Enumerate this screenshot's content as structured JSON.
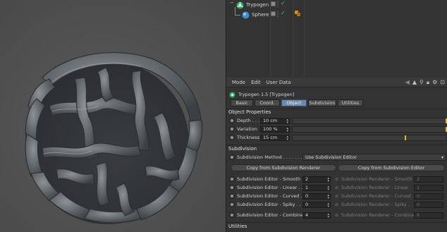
{
  "object_manager": {
    "objects": [
      {
        "name": "Trypogen",
        "icon": "trypogen-icon",
        "icon_color": "#2fae61"
      },
      {
        "name": "Sphere",
        "icon": "sphere-icon",
        "icon_color": "#4aa3df"
      }
    ]
  },
  "attribute_manager": {
    "menu": [
      "Mode",
      "Edit",
      "User Data"
    ],
    "object_title": "Trypogen 1.5 [Trypogen]",
    "tabs": [
      "Basic",
      "Coord.",
      "Object",
      "Subdivision",
      "Utilities"
    ],
    "active_tab": "Object",
    "object_properties": {
      "header": "Object Properties",
      "depth": {
        "label": "Depth . . . .",
        "value": "10 cm",
        "fraction": 1.0
      },
      "variation": {
        "label": "Variation",
        "value": "100 %",
        "fraction": 1.0
      },
      "thickness": {
        "label": "Thickness",
        "value": "15 cm",
        "fraction": 0.73
      }
    },
    "subdivision": {
      "header": "Subdivision",
      "method_label": "Subdivision Method . . . . . . . . .",
      "method_value": "Use Subdivision Editor",
      "copy_renderer_button": "Copy from Subdivision Renderer",
      "copy_editor_button": "Copy from Subdivision Editor",
      "rows": [
        {
          "editor_label": "Subdivision Editor - Smooth",
          "editor_value": "2",
          "renderer_label": "Subdivision Renderer - Smooth",
          "renderer_value": "2"
        },
        {
          "editor_label": "Subdivision Editor - Linear . .",
          "editor_value": "1",
          "renderer_label": "Subdivision Renderer - Linear . .",
          "renderer_value": "1"
        },
        {
          "editor_label": "Subdivision Editor - Curved . .",
          "editor_value": "0",
          "renderer_label": "Subdivision Renderer - Curved . .",
          "renderer_value": "0"
        },
        {
          "editor_label": "Subdivision Editor - Spiky . .",
          "editor_value": "0",
          "renderer_label": "Subdivision Renderer - Spiky . .",
          "renderer_value": "0"
        },
        {
          "editor_label": "Subdivision Editor - Combined",
          "editor_value": "4",
          "renderer_label": "Subdivision Renderer - Combined",
          "renderer_value": "6"
        }
      ]
    },
    "utilities_header": "Utilities"
  }
}
